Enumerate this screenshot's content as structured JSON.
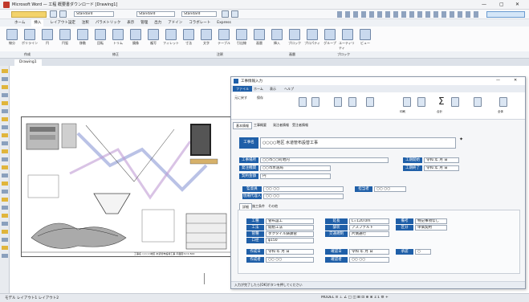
{
  "app": {
    "title": "Microsoft Word — 工程 概要書ダウンロード [Drawing1]",
    "window_controls": {
      "min": "—",
      "max": "▢",
      "close": "✕"
    }
  },
  "toolbar": {
    "combo1": "Standard",
    "combo2": "Standard",
    "combo3": "Standard"
  },
  "ribbon": {
    "tabs": [
      "ホーム",
      "挿入",
      "レイアウト設定",
      "注釈",
      "パラメトリック",
      "表示",
      "管理",
      "出力",
      "アドイン",
      "コラボレート",
      "Express"
    ],
    "active_tab": "ホーム",
    "buttons": [
      "線分",
      "ポリライン",
      "円",
      "円弧",
      "移動",
      "回転",
      "トリム",
      "鏡像",
      "複写",
      "フィレット",
      "寸法",
      "文字",
      "テーブル",
      "引出線",
      "画層",
      "挿入",
      "ブロック",
      "プロパティ",
      "グループ",
      "ユーティリティ",
      "ビュー"
    ],
    "groups": [
      "作成",
      "修正",
      "注釈",
      "画層",
      "ブロック"
    ]
  },
  "doc_tabs": [
    "Drawing1"
  ],
  "status_bar": {
    "left": "モデル レイアウト1 レイアウト2",
    "right": "MODEL ≡ ⊥ ∠ □ ◫ ⊞ ⊡ ⊕ ⊗ 1:1 ⚙ +"
  },
  "dialog": {
    "title": "工事情報入力",
    "tabs": [
      "ファイル",
      "ホーム",
      "表示",
      "ヘルプ"
    ],
    "active_tab": "ホーム",
    "toolbar_labels": [
      "元に戻す",
      "保存",
      "貼付け",
      "コピー",
      "切取り",
      "検索",
      "印刷",
      "計算",
      "合計",
      "書式",
      "編集",
      "全体"
    ],
    "sub_tabs": [
      "基本情報",
      "工事概要",
      "発注者情報",
      "受注者情報"
    ],
    "project_name_label": "工事名",
    "project_name_value": "○○○○地区 水道管布設替工事",
    "rows": [
      {
        "label": "工事場所",
        "value": "○○市○○町地内",
        "side_label": "工期開始",
        "side_value": "令和 年 月 日"
      },
      {
        "label": "発注機関",
        "value": "○○市水道局",
        "side_label": "工期終了",
        "side_value": "令和 年 月 日"
      },
      {
        "label": "契約金額",
        "value": "円",
        "side_label": "",
        "side_value": ""
      },
      {
        "label": "監督員",
        "value": "○○ ○○",
        "side_label": "担当者",
        "side_value": "○○ ○○"
      },
      {
        "label": "現場代理人",
        "value": "○○ ○○",
        "side_label": "",
        "side_value": ""
      }
    ],
    "section_tabs": [
      "詳細",
      "施工条件",
      "その他"
    ],
    "detail": {
      "col1": [
        {
          "label": "工種",
          "value": "管布設工"
        },
        {
          "label": "工法",
          "value": "開削工法"
        },
        {
          "label": "管種",
          "value": "ダクタイル鋳鉄管"
        },
        {
          "label": "口径",
          "value": "φ150"
        }
      ],
      "col2": [
        {
          "label": "延長",
          "value": "L=120.0m"
        },
        {
          "label": "舗装",
          "value": "アスファルト"
        },
        {
          "label": "交通規制",
          "value": "片側通行"
        }
      ],
      "col3": [
        {
          "label": "備考",
          "value": "特記事項なし"
        },
        {
          "label": "区分",
          "value": "単価契約"
        }
      ],
      "bottom": [
        {
          "label": "作成日",
          "value": "令和 年 月 日"
        },
        {
          "label": "作成者",
          "value": "○○ ○○"
        },
        {
          "label": "確認日",
          "value": "令和 年 月 日"
        },
        {
          "label": "確認者",
          "value": "○○ ○○"
        },
        {
          "label": "承認",
          "value": "○"
        }
      ]
    },
    "status": "入力が完了したら[OK]ボタンを押してください"
  },
  "drawing": {
    "title_block": "工事名 ○○○○地区 水道管布設替工事 平面図 S=1:500"
  },
  "colors": {
    "accent": "#1f5fa8",
    "ribbon_bg": "#f7f8fa",
    "canvas": "#ffffff"
  }
}
